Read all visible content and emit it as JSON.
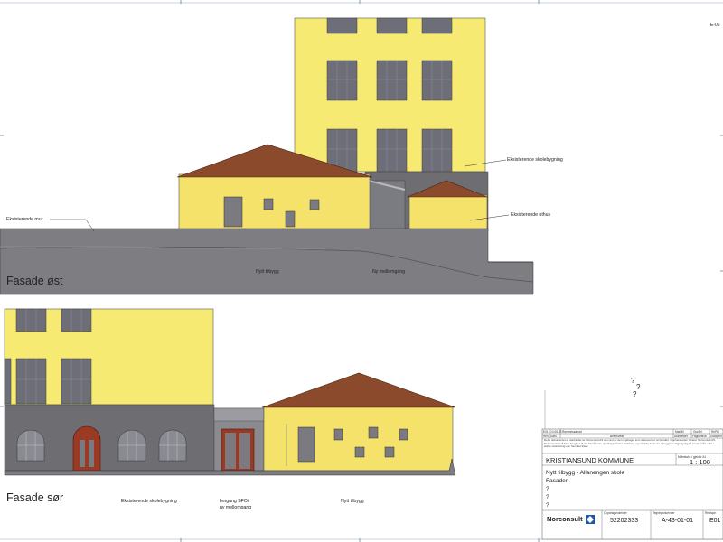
{
  "sheet_code": "E-06",
  "east": {
    "title": "Fasade øst",
    "labels": {
      "existing_school": "Eksisterende skolebygning",
      "existing_outhouse": "Eksisterende uthus",
      "existing_wall": "Eksisterende mur",
      "new_building": "Nytt tilbygg",
      "new_corridor": "Ny mellomgang"
    }
  },
  "south": {
    "title": "Fasade sør",
    "labels": {
      "existing_school": "Eksisterende skolebygning",
      "entrance_line1": "Inngang SFO/",
      "entrance_line2": "ny mellomgang",
      "new_building": "Nytt tilbygg"
    }
  },
  "question_marks": [
    "?",
    "?",
    "?"
  ],
  "title_block": {
    "revision_row": {
      "rev": "E01",
      "date": "10.06.23",
      "description": "Rammesøknad",
      "made_by": "MarMil",
      "checked": "GunErl",
      "approved": "RePAl"
    },
    "revision_headers": {
      "rev": "Rev.",
      "date": "Dato",
      "description": "Beskrivelse",
      "made_by": "Utarbeidet",
      "checked": "Fagkontroll",
      "approved": "Godkjent"
    },
    "disclaimer": "Dette dokumentet er utarbeidet av Norconsult AS som del av det oppdraget som dokumentet omhandler. Opphavsretten tilhører Norconsult AS. Dokumentet må bare benyttes til det formål som oppdragsavtalen beskriver, og må ikke kopieres eller gjøres tilgjengelig på annen måte eller i større utstrekning enn formålet tilsier.",
    "scale_header": "Målestokk / gjelder A1",
    "scale": "1 : 100",
    "client": "KRISTIANSUND KOMMUNE",
    "project": "Nytt tilbygg - Allanengen skole",
    "drawing": "Fasader",
    "extra_lines": [
      "?",
      "?",
      "?"
    ],
    "company": "Norconsult",
    "assignment_header": "Oppdragsnummer",
    "assignment_number": "52202333",
    "drawing_header": "Tegningsnummer",
    "drawing_number": "A-43-01-01",
    "revision_header": "Revisjon",
    "revision": "E01"
  }
}
